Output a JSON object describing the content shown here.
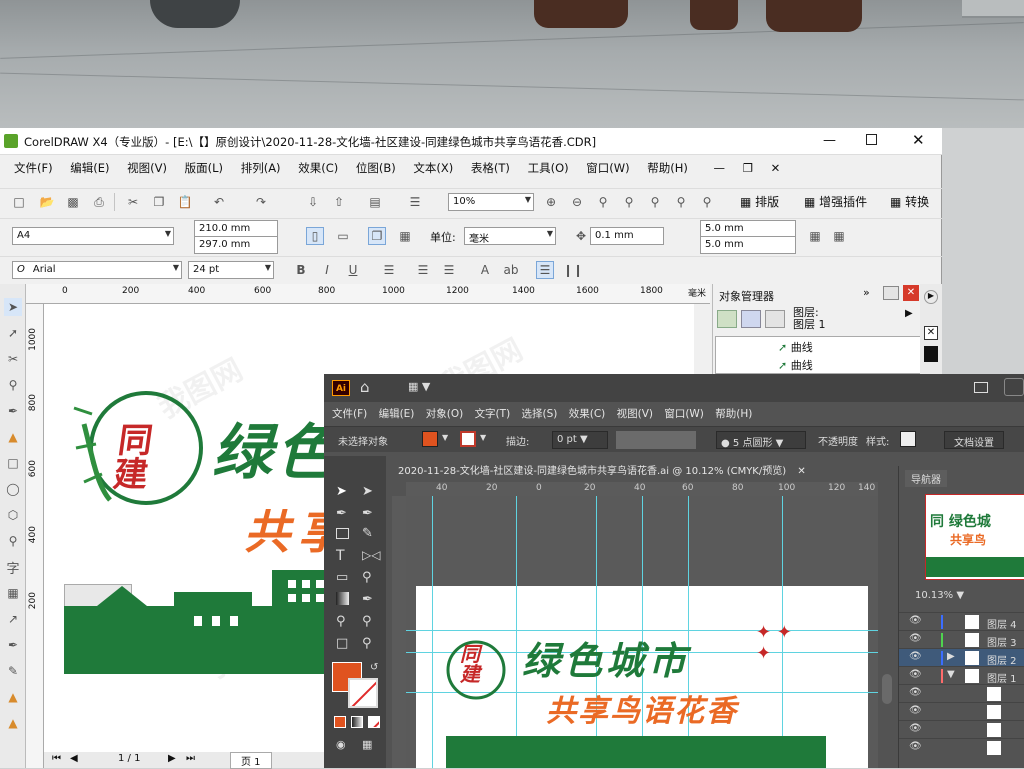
{
  "corel": {
    "title": "CorelDRAW X4（专业版）- [E:\\【】原创设计\\2020-11-28-文化墙-社区建设-同建绿色城市共享鸟语花香.CDR]",
    "menu": [
      "文件(F)",
      "编辑(E)",
      "视图(V)",
      "版面(L)",
      "排列(A)",
      "效果(C)",
      "位图(B)",
      "文本(X)",
      "表格(T)",
      "工具(O)",
      "窗口(W)",
      "帮助(H)"
    ],
    "zoom": "10%",
    "toolbar_right": {
      "layout": "排版",
      "plugin": "增强插件",
      "convert": "转换"
    },
    "paper": "A4",
    "width": "210.0 mm",
    "height": "297.0 mm",
    "unit_label": "单位:",
    "unit": "毫米",
    "nudge": "0.1 mm",
    "dup_x": "5.0 mm",
    "dup_y": "5.0 mm",
    "font": "Arial",
    "font_size": "24 pt",
    "ruler_h": [
      "0",
      "200",
      "400",
      "600",
      "800",
      "1000",
      "1200",
      "1400",
      "1600",
      "1800"
    ],
    "ruler_unit": "毫米",
    "ruler_v": [
      "1000",
      "800",
      "600",
      "400",
      "200"
    ],
    "page_nav": "1 / 1",
    "page_tab": "页 1",
    "obj_manager": {
      "title": "对象管理器",
      "layer": "图层:",
      "layer_name": "图层 1",
      "items": [
        "曲线",
        "曲线"
      ]
    },
    "art": {
      "logo": "同建",
      "line1": "绿色",
      "line2": "共享"
    }
  },
  "ai": {
    "logo": "Ai",
    "menu": [
      "文件(F)",
      "编辑(E)",
      "对象(O)",
      "文字(T)",
      "选择(S)",
      "效果(C)",
      "视图(V)",
      "窗口(W)",
      "帮助(H)"
    ],
    "no_selection": "未选择对象",
    "stroke_label": "描边:",
    "stroke_value": "0 pt",
    "brush": "5 点圆形",
    "opacity": "不透明度",
    "style": "样式:",
    "doc_settings": "文档设置",
    "doc_tab": "2020-11-28-文化墙-社区建设-同建绿色城市共享鸟语花香.ai @ 10.12% (CMYK/预览)",
    "ruler": [
      "40",
      "20",
      "0",
      "20",
      "40",
      "60",
      "80",
      "100",
      "120",
      "140"
    ],
    "navigator": "导航器",
    "nav_zoom": "10.13%",
    "layers": [
      "图层 4",
      "图层 3",
      "图层 2",
      "图层 1"
    ],
    "layer_colors": [
      "#3b6dff",
      "#4fd34f",
      "#3b6dff",
      "#ff6b6b"
    ],
    "art": {
      "logo": "同建",
      "line1": "绿色城市",
      "line2": "共享鸟语花香"
    },
    "fill_color": "#e0531f"
  },
  "colors": {
    "green": "#1f7a3a",
    "orange": "#ea6a25",
    "red": "#c62828"
  }
}
